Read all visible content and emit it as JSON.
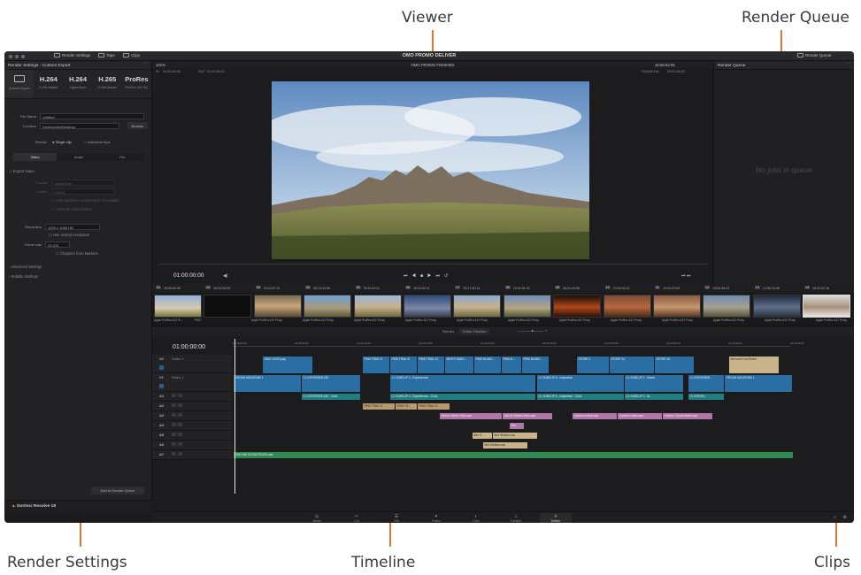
{
  "callouts": {
    "viewer": "Viewer",
    "render_queue": "Render Queue",
    "render_settings": "Render Settings",
    "timeline": "Timeline",
    "clips": "Clips"
  },
  "titlebar": {
    "title": "OMO PROMO DELIVER",
    "render_settings_btn": "Render Settings",
    "tape_btn": "Tape",
    "clips_btn": "Clips",
    "render_queue_btn": "Render Queue"
  },
  "render_settings": {
    "title": "Render Settings - Custom Export",
    "presets": [
      {
        "big": "",
        "small": "Custom Export"
      },
      {
        "big": "H.264",
        "small": "H.264 Master"
      },
      {
        "big": "H.264",
        "small": "HyperDeck"
      },
      {
        "big": "H.265",
        "small": "H.265 Master"
      },
      {
        "big": "ProRes",
        "small": "ProRes 422 HQ"
      }
    ],
    "filename_label": "File Name",
    "filename_value": "Untitled",
    "location_label": "Location",
    "location_value": "/Users/chris/Desktop",
    "browse": "Browse",
    "render_label": "Render",
    "single_clip": "Single clip",
    "individual_clips": "Individual clips",
    "tabs": [
      "Video",
      "Audio",
      "File"
    ],
    "export_video": "Export Video",
    "format_label": "Format",
    "format_value": "QuickTime",
    "codec_label": "Codec",
    "codec_value": "H.264",
    "hw_accel": "Use hardware acceleration if available",
    "network_opt": "Network Optimization",
    "resolution_label": "Resolution",
    "resolution_value": "1920 x 1080 HD",
    "vertical_res": "Use vertical resolution",
    "framerate_label": "Frame rate",
    "framerate_value": "23.976",
    "chapters": "Chapters from Markers",
    "advanced": "Advanced Settings",
    "subtitle": "Subtitle Settings",
    "add_to_queue": "Add to Render Queue",
    "brand": "DaVinci Resolve 18"
  },
  "viewer": {
    "zoom": "101%",
    "timeline_name": "OMO PROMO FINISHED",
    "timecode_top": "15:55:52:06",
    "in_label": "IN",
    "in_value": "01:00:00:00",
    "out_label": "OUT",
    "out_value": "01:00:56:01",
    "duration_label": "DURATION",
    "duration_value": "00:00:56:02",
    "current_tc": "01:00:00:00"
  },
  "render_queue": {
    "title": "Render Queue",
    "empty": "No jobs in queue"
  },
  "clips_bar": {
    "items": [
      {
        "n": "01",
        "tc": "15:55:52:06"
      },
      {
        "n": "02",
        "tc": "00:00:00:00"
      },
      {
        "n": "03",
        "tc": "15:43:57:21"
      },
      {
        "n": "04",
        "tc": "05:13:41:06"
      },
      {
        "n": "05",
        "tc": "05:11:00:11"
      },
      {
        "n": "06",
        "tc": "16:24:32:11"
      },
      {
        "n": "07",
        "tc": "05:17:00:14"
      },
      {
        "n": "08",
        "tc": "19:41:51:02"
      },
      {
        "n": "09",
        "tc": "08:41:41:06"
      },
      {
        "n": "10",
        "tc": "19:05:33:21"
      },
      {
        "n": "11",
        "tc": "19:03:23:09"
      },
      {
        "n": "12",
        "tc": "15:54:36:23"
      },
      {
        "n": "13",
        "tc": "12:56:33:06"
      },
      {
        "n": "14",
        "tc": "16:02:02:16"
      }
    ],
    "format_first": "Apple ProRes 422 Pr...",
    "format_png": "PNG",
    "format_proxy": "Apple ProRes 422 Proxy"
  },
  "timeline": {
    "render_label": "Render",
    "render_value": "Entire Timeline",
    "timecode": "01:00:00:00",
    "ruler": [
      "01:00:00:00",
      "01:00:05:00",
      "01:00:10:00",
      "01:00:15:00",
      "01:00:20:00",
      "01:00:25:00",
      "01:00:30:00",
      "01:00:35:00",
      "01:00:40:00",
      "01:00:45:00"
    ],
    "tracks": [
      {
        "id": "V2",
        "name": "Video 2"
      },
      {
        "id": "V1",
        "name": "Video 1"
      },
      {
        "id": "A1",
        "name": ""
      },
      {
        "id": "A2",
        "name": ""
      },
      {
        "id": "A3",
        "name": ""
      },
      {
        "id": "A4",
        "name": ""
      },
      {
        "id": "A5",
        "name": ""
      },
      {
        "id": "A6",
        "name": ""
      },
      {
        "id": "A7",
        "name": ""
      }
    ],
    "clips": {
      "omo_logo": "OMO LOGO.png",
      "pink_trail_b": "PINK TRAIL B",
      "pink_trail_b2": "PINK TRAIL B",
      "pink_trail_12": "PINK TRAIL 12",
      "white_sand": "WHITE SAND...",
      "pink_blanc": "PINK BLANC...",
      "pink_b": "PINK B...",
      "pink_blanc2": "PINK BLANC...",
      "store2": "STORE 2",
      "store34": "STORE 34",
      "store28": "STORE 28",
      "memorial": "Memorial Line Breed",
      "organ1": "ORGAN MOUNTAIN 1",
      "cl_int_182": "CL INTERVIEW 182",
      "cl_subclip_exp": "CL SUBCLIP 3 - Experiences",
      "cl_subclip_insp": "CL SUBCLIP 6 - Inspiration",
      "cl_subclip_brand": "CL SUBCLIP 2 - Brand",
      "cl_interview": "CL INTERVIEW...",
      "organ2": "ORGAN MOUNTAIN 1",
      "a_int_182": "CL INTERVIEW 182 - Chris",
      "a_sub_exp": "CL SUBCLIP 3 - Experiences - Chris",
      "a_sub_insp": "CL SUBCLIP 6 - Inspiration - Chris",
      "a_sub_brand": "CL SUBCLIP 2 - Br...",
      "a_interview": "CL INTERV...",
      "a2_trail8": "PINK TRAIL B",
      "a2_trail2": "PINK TR...",
      "a2_trail12": "PINK TRAIL 12",
      "a3_xtreme": "Xtreme Winter Wind.wav",
      "a3_salt": "Salt-Air Stories Birds.wav",
      "a3_cheerful": "Cheerful chime.wav",
      "a3_cheerful2": "Cheerful chime.wav",
      "a3_outdoor": "Outdoor Crowd Muffle.wav",
      "a4_bird": "Bird...",
      "a5_bird": "Bird S...",
      "a5_bird2": "Bird Whistle.wav",
      "a6_bird": "Bird Whistle.wav",
      "a7_sound": "ONE MIN SOUNDTRACK.wav"
    }
  },
  "pages": [
    {
      "icon": "media-icon",
      "label": "Media"
    },
    {
      "icon": "cut-icon",
      "label": "Cut"
    },
    {
      "icon": "edit-icon",
      "label": "Edit"
    },
    {
      "icon": "fusion-icon",
      "label": "Fusion"
    },
    {
      "icon": "color-icon",
      "label": "Color"
    },
    {
      "icon": "fairlight-icon",
      "label": "Fairlight"
    },
    {
      "icon": "deliver-icon",
      "label": "Deliver"
    }
  ],
  "colors": {
    "accent_callout": "#d9783d",
    "clip_blue": "#2a6fa3",
    "clip_teal": "#1f7f82",
    "clip_pink": "#b275a8",
    "clip_green": "#2f8a52"
  }
}
